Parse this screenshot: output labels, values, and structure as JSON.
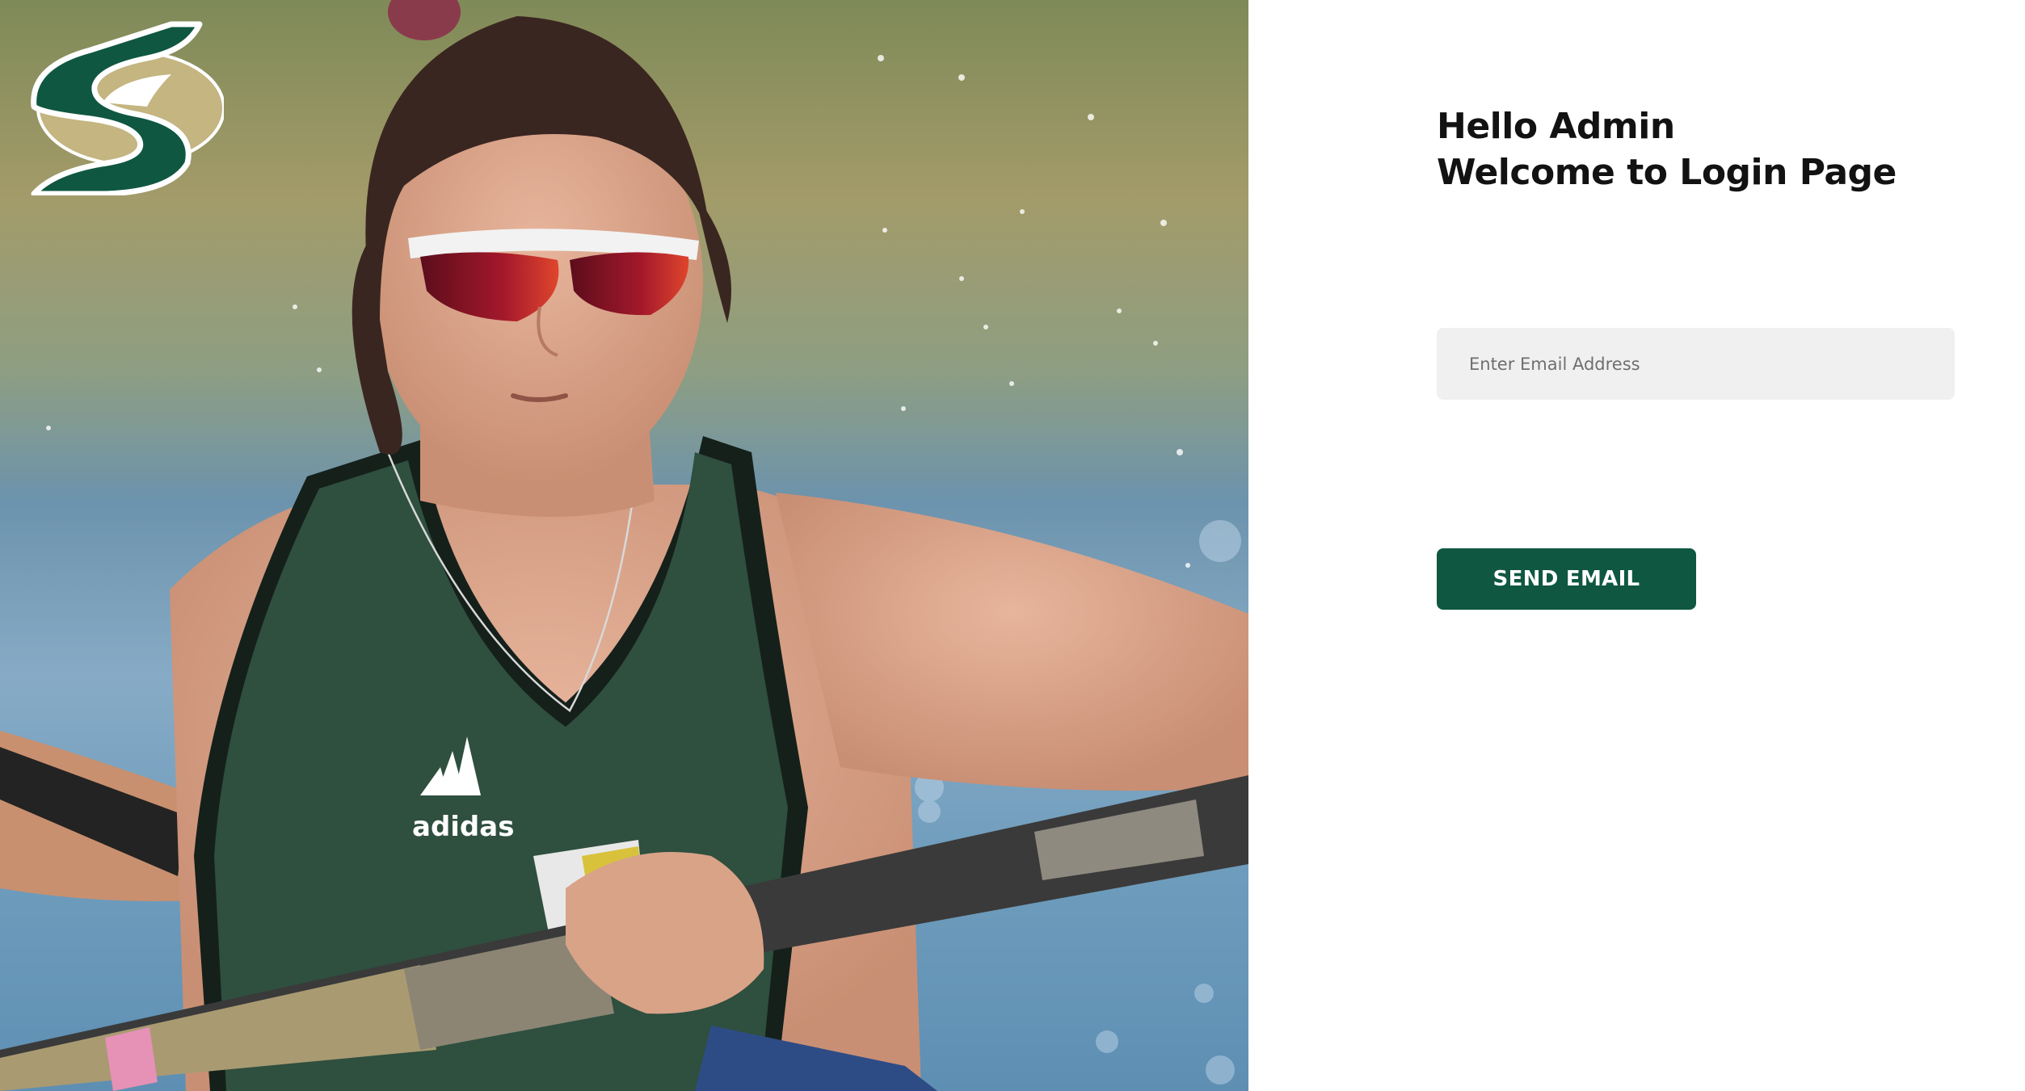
{
  "greeting": {
    "line1": "Hello Admin",
    "line2": "Welcome to Login Page"
  },
  "email": {
    "placeholder": "Enter Email Address",
    "value": ""
  },
  "send_button": {
    "label": "SEND EMAIL"
  },
  "logo": {
    "icon": "sacramento-state-s-logo",
    "colors": {
      "green": "#0f5741",
      "gold": "#c4b581"
    }
  },
  "photo": {
    "icon": "rower-photo",
    "jersey_logo_text": "adidas"
  },
  "colors": {
    "accent": "#0f5741",
    "input_background": "#f0f0f0",
    "heading": "#121212"
  }
}
